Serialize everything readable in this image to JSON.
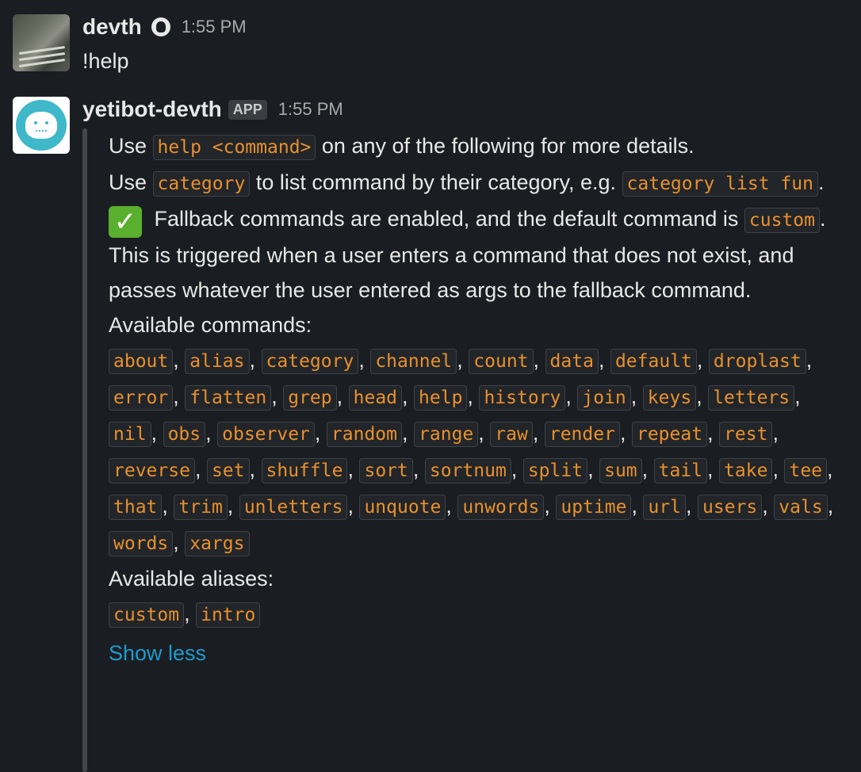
{
  "messages": [
    {
      "sender": "devth",
      "time": "1:55 PM",
      "text": "!help"
    },
    {
      "sender": "yetibot-devth",
      "badge": "APP",
      "time": "1:55 PM",
      "intro": {
        "line1_prefix": "Use ",
        "line1_code": "help <command>",
        "line1_suffix": " on any of the following for more details.",
        "line2_prefix": "Use ",
        "line2_code": "category",
        "line2_middle": " to list command by their category,  e.g. ",
        "line2_code2": "category list fun",
        "line2_suffix": "."
      },
      "fallback": {
        "emoji": "✓",
        "prefix": " Fallback commands are enabled, and the default command is ",
        "code": "custom",
        "suffix": ". This is triggered when a user enters a command that does not exist, and passes whatever the user entered as args to the fallback command."
      },
      "commands_label": "Available commands:",
      "commands": [
        "about",
        "alias",
        "category",
        "channel",
        "count",
        "data",
        "default",
        "droplast",
        "error",
        "flatten",
        "grep",
        "head",
        "help",
        "history",
        "join",
        "keys",
        "letters",
        "nil",
        "obs",
        "observer",
        "random",
        "range",
        "raw",
        "render",
        "repeat",
        "rest",
        "reverse",
        "set",
        "shuffle",
        "sort",
        "sortnum",
        "split",
        "sum",
        "tail",
        "take",
        "tee",
        "that",
        "trim",
        "unletters",
        "unquote",
        "unwords",
        "uptime",
        "url",
        "users",
        "vals",
        "words",
        "xargs"
      ],
      "aliases_label": "Available aliases:",
      "aliases": [
        "custom",
        "intro"
      ],
      "show_less": "Show less"
    }
  ],
  "colors": {
    "background": "#1a1d21",
    "code_text": "#e8912d",
    "link": "#1d9bd1",
    "check_emoji": "#5ab02e"
  },
  "icons": {
    "status": "yeti-status-icon",
    "check": "check-mark-emoji-icon"
  }
}
